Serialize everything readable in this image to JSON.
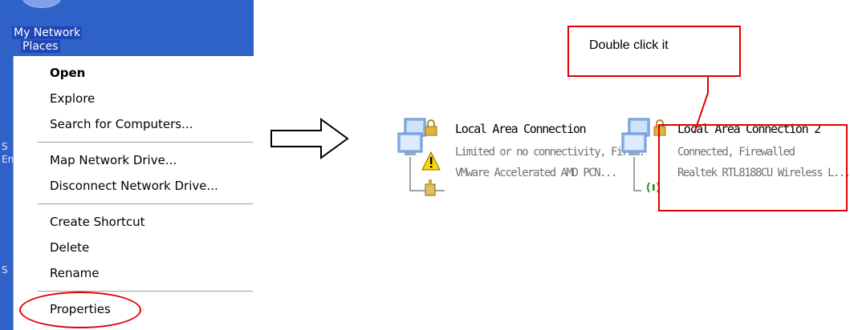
{
  "desktop": {
    "icon_label_line1": "My Network",
    "icon_label_line2": "Places"
  },
  "context_menu": {
    "items": [
      {
        "label": "Open",
        "default": true
      },
      {
        "label": "Explore"
      },
      {
        "label": "Search for Computers..."
      },
      {
        "label": "Map Network Drive..."
      },
      {
        "label": "Disconnect Network Drive..."
      },
      {
        "label": "Create Shortcut"
      },
      {
        "label": "Delete"
      },
      {
        "label": "Rename"
      },
      {
        "label": "Properties",
        "circled": true
      }
    ]
  },
  "callout": {
    "text": "Double click it"
  },
  "connections": [
    {
      "name": "Local Area Connection",
      "status": "Limited or no connectivity, Fir...",
      "device": "VMware Accelerated AMD PCN...",
      "icon": "network-connection-warning-icon"
    },
    {
      "name": "Local Area Connection 2",
      "status": "Connected, Firewalled",
      "device": "Realtek RTL8188CU Wireless L...",
      "icon": "network-connection-wireless-icon"
    }
  ],
  "colors": {
    "annotation_red": "#e00000",
    "desktop_blue": "#2f62c8",
    "secondary_text": "#707070"
  }
}
